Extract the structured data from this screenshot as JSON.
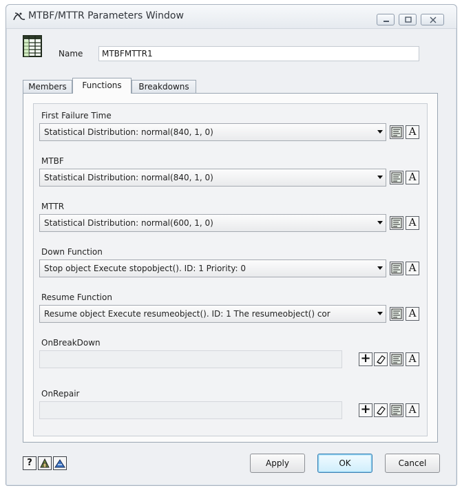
{
  "window": {
    "title": "MTBF/MTTR Parameters Window",
    "icon": "flexsim-logo-icon"
  },
  "name_field": {
    "label": "Name",
    "value": "MTBFMTTR1"
  },
  "tabs": [
    {
      "label": "Members",
      "active": false
    },
    {
      "label": "Functions",
      "active": true
    },
    {
      "label": "Breakdowns",
      "active": false
    }
  ],
  "fields": {
    "first_failure_time": {
      "label": "First Failure Time",
      "value": "Statistical Distribution: normal(840, 1, 0)"
    },
    "mtbf": {
      "label": "MTBF",
      "value": "Statistical Distribution: normal(840, 1, 0)"
    },
    "mttr": {
      "label": "MTTR",
      "value": "Statistical Distribution: normal(600, 1, 0)"
    },
    "down_function": {
      "label": "Down Function",
      "value": "Stop object Execute stopobject(). ID: 1 Priority: 0"
    },
    "resume_function": {
      "label": "Resume Function",
      "value": "Resume object Execute resumeobject(). ID: 1 The resumeobject() cor"
    },
    "on_breakdown": {
      "label": "OnBreakDown",
      "value": ""
    },
    "on_repair": {
      "label": "OnRepair",
      "value": ""
    }
  },
  "button_glyphs": {
    "text_edit": "A",
    "add": "+",
    "help": "?"
  },
  "buttons": {
    "apply": "Apply",
    "ok": "OK",
    "cancel": "Cancel"
  },
  "colors": {
    "window_bg": "#eef0f3",
    "ok_accent": "#3c7fb1"
  }
}
